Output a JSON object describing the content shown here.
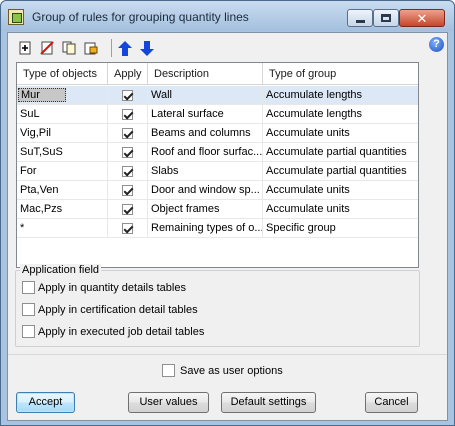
{
  "window": {
    "title": "Group of rules for grouping quantity lines",
    "close_glyph": "✕"
  },
  "toolbar": {
    "buttons": [
      "new-icon",
      "delete-icon",
      "copy-icon",
      "edit-icon",
      "move-up-icon",
      "move-down-icon"
    ],
    "help_glyph": "?"
  },
  "table": {
    "headers": [
      "Type of objects",
      "Apply",
      "Description",
      "Type of group"
    ],
    "rows": [
      {
        "type": "Mur",
        "apply": true,
        "description": "Wall",
        "group": "Accumulate lengths"
      },
      {
        "type": "SuL",
        "apply": true,
        "description": "Lateral surface",
        "group": "Accumulate lengths"
      },
      {
        "type": "Vig,Pil",
        "apply": true,
        "description": "Beams and columns",
        "group": "Accumulate units"
      },
      {
        "type": "SuT,SuS",
        "apply": true,
        "description": "Roof and floor surfac...",
        "group": "Accumulate partial quantities"
      },
      {
        "type": "For",
        "apply": true,
        "description": "Slabs",
        "group": "Accumulate partial quantities"
      },
      {
        "type": "Pta,Ven",
        "apply": true,
        "description": "Door and window sp...",
        "group": "Accumulate units"
      },
      {
        "type": "Mac,Pzs",
        "apply": true,
        "description": "Object frames",
        "group": "Accumulate units"
      },
      {
        "type": "*",
        "apply": true,
        "description": "Remaining types of o...",
        "group": "Specific group"
      }
    ]
  },
  "application_field": {
    "title": "Application field",
    "options": [
      {
        "label": "Apply in quantity details tables",
        "checked": false
      },
      {
        "label": "Apply in certification detail tables",
        "checked": false
      },
      {
        "label": "Apply in executed job detail tables",
        "checked": false
      }
    ]
  },
  "save_user_options": {
    "label": "Save as user options",
    "checked": false
  },
  "buttons": {
    "accept": "Accept",
    "user_values": "User values",
    "default_settings": "Default settings",
    "cancel": "Cancel"
  }
}
